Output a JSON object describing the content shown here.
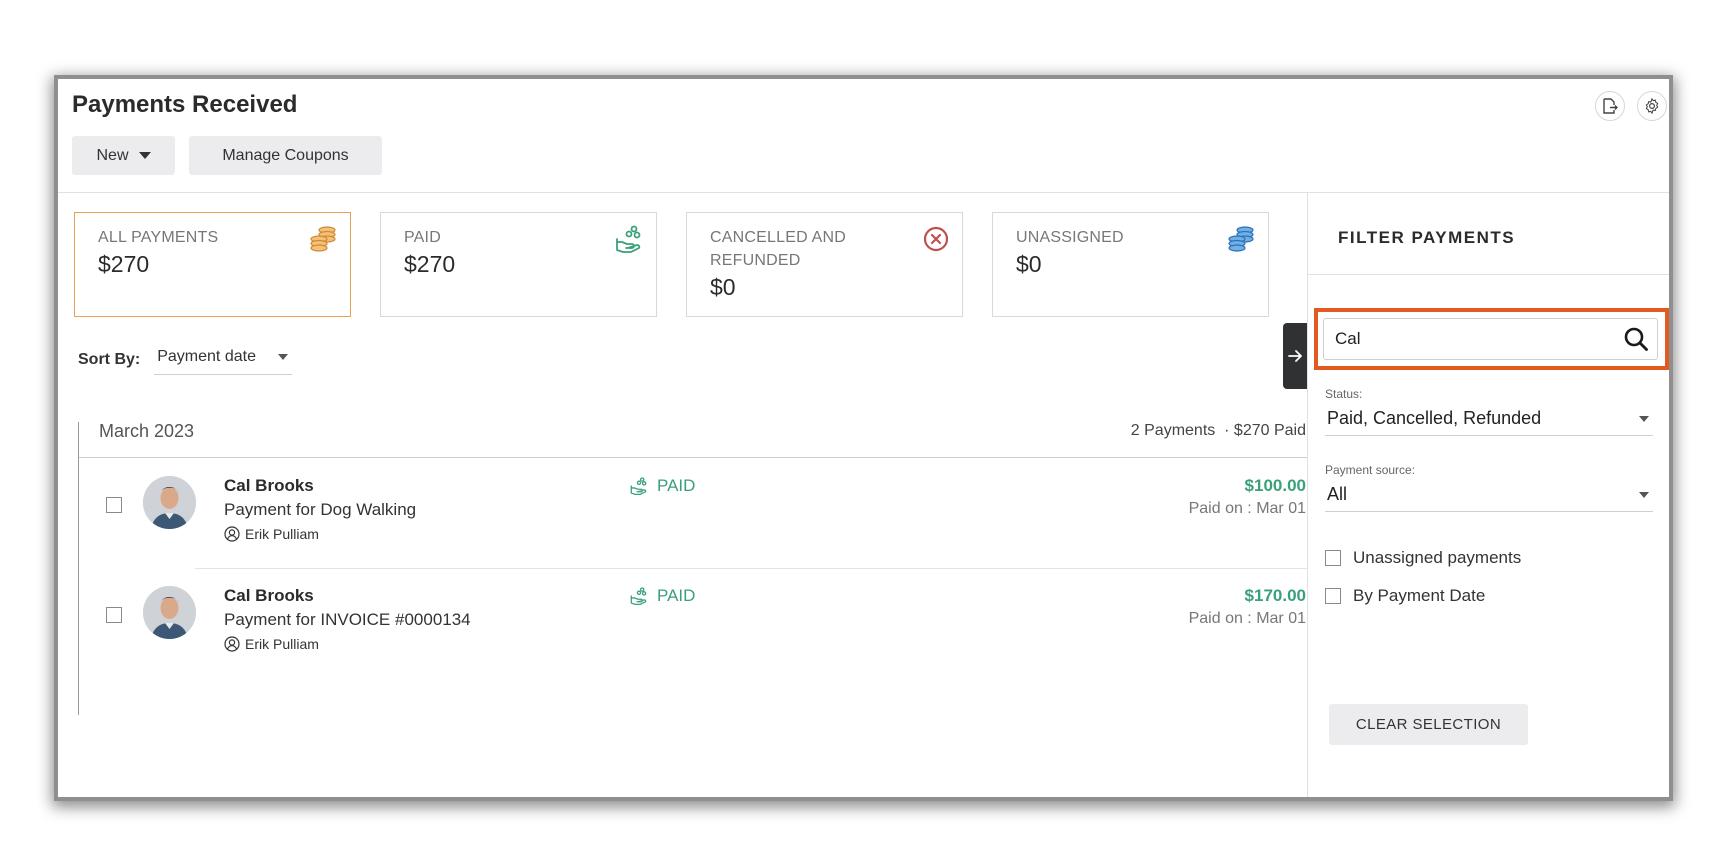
{
  "header": {
    "title": "Payments Received",
    "new_label": "New",
    "manage_coupons_label": "Manage Coupons",
    "export_icon": "export-icon",
    "settings_icon": "gear-icon"
  },
  "summary_cards": [
    {
      "label": "ALL PAYMENTS",
      "amount": "$270",
      "icon": "coins-stack-icon",
      "active": true
    },
    {
      "label": "PAID",
      "amount": "$270",
      "icon": "hand-coins-icon",
      "active": false
    },
    {
      "label": "CANCELLED AND REFUNDED",
      "amount": "$0",
      "icon": "cancel-circle-icon",
      "active": false
    },
    {
      "label": "UNASSIGNED",
      "amount": "$0",
      "icon": "coins-stack-icon",
      "active": false
    }
  ],
  "sort": {
    "label": "Sort By:",
    "value": "Payment date"
  },
  "month": {
    "title": "March 2023",
    "summary": "2 Payments  · $270 Paid"
  },
  "payments": [
    {
      "payer": "Cal Brooks",
      "description": "Payment for Dog Walking",
      "staff": "Erik Pulliam",
      "status": "PAID",
      "amount": "$100.00",
      "paid_on": "Paid on : Mar 01"
    },
    {
      "payer": "Cal Brooks",
      "description": "Payment for INVOICE #0000134",
      "staff": "Erik Pulliam",
      "status": "PAID",
      "amount": "$170.00",
      "paid_on": "Paid on : Mar 01"
    }
  ],
  "filter": {
    "title": "FILTER PAYMENTS",
    "search_value": "Cal",
    "status_label": "Status:",
    "status_value": "Paid, Cancelled, Refunded",
    "source_label": "Payment source:",
    "source_value": "All",
    "unassigned_label": "Unassigned payments",
    "by_date_label": "By Payment Date",
    "clear_label": "CLEAR SELECTION"
  },
  "colors": {
    "accent_orange": "#e8a057",
    "highlight_red": "#e05a22",
    "paid_green": "#3aa07a",
    "cancel_red": "#c0504d",
    "unassigned_blue": "#3b82c4"
  }
}
